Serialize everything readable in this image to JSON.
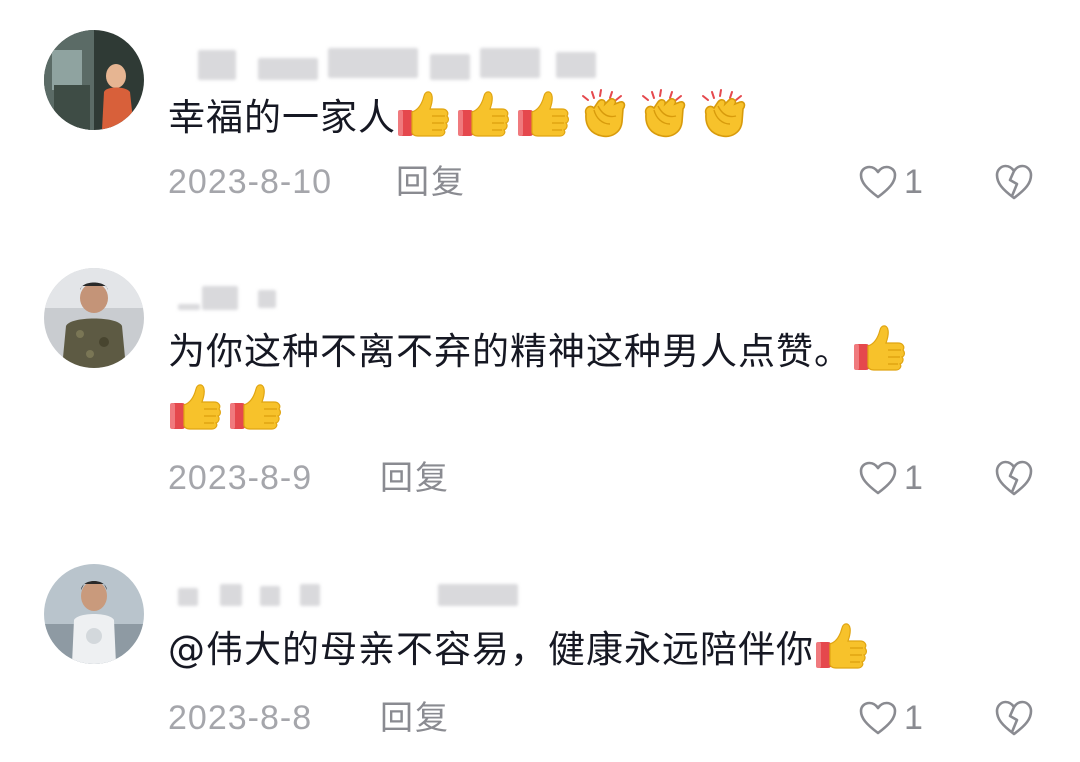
{
  "comments": [
    {
      "text": "幸福的一家人",
      "emojis": [
        "thumbs-up",
        "thumbs-up",
        "thumbs-up",
        "clapping-hands",
        "clapping-hands",
        "clapping-hands"
      ],
      "date": "2023-8-10",
      "reply_label": "回复",
      "like_count": "1"
    },
    {
      "text": "为你这种不离不弃的精神这种男人点赞。",
      "emojis": [
        "thumbs-up",
        "thumbs-up",
        "thumbs-up"
      ],
      "date": "2023-8-9",
      "reply_label": "回复",
      "like_count": "1"
    },
    {
      "text": "@伟大的母亲不容易，健康永远陪伴你",
      "emojis": [
        "thumbs-up"
      ],
      "date": "2023-8-8",
      "reply_label": "回复",
      "like_count": "1"
    }
  ],
  "colors": {
    "text": "#161823",
    "date": "#a5a6ab",
    "action": "#8a8b91",
    "thumb_yellow": "#f7c22b",
    "cuff_red": "#e5484d"
  },
  "icons": {
    "like": "heart-outline-icon",
    "dislike": "broken-heart-icon"
  }
}
